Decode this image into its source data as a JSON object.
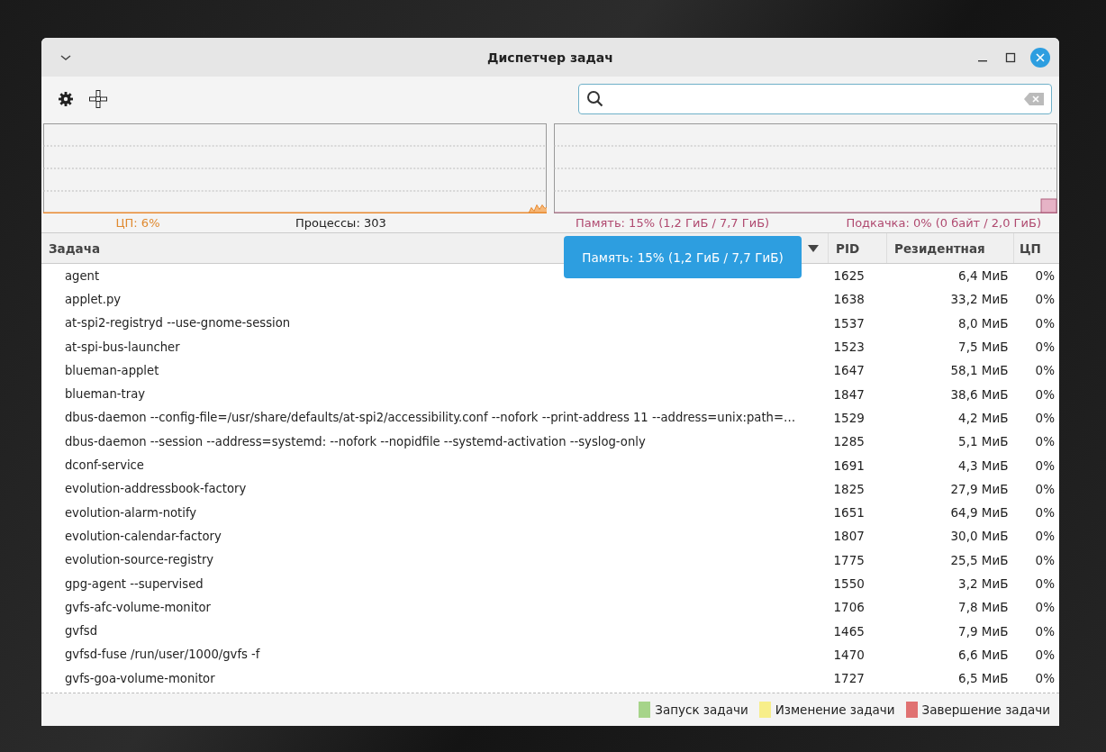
{
  "window": {
    "title": "Диспетчер задач"
  },
  "stats": {
    "cpu": "ЦП: 6%",
    "processes": "Процессы: 303",
    "memory": "Память: 15% (1,2 ГиБ / 7,7 ГиБ)",
    "swap": "Подкачка: 0% (0 байт / 2,0 ГиБ)"
  },
  "tooltip": {
    "text": "Память: 15% (1,2 ГиБ / 7,7 ГиБ)"
  },
  "table": {
    "columns": [
      {
        "label": "Задача",
        "sorted": true
      },
      {
        "label": "PID",
        "sorted": false
      },
      {
        "label": "Резидентная",
        "sorted": false
      },
      {
        "label": "ЦП",
        "sorted": false
      }
    ],
    "rows": [
      [
        "agent",
        "1625",
        "6,4 МиБ",
        "0%"
      ],
      [
        "applet.py",
        "1638",
        "33,2 МиБ",
        "0%"
      ],
      [
        "at-spi2-registryd --use-gnome-session",
        "1537",
        "8,0 МиБ",
        "0%"
      ],
      [
        "at-spi-bus-launcher",
        "1523",
        "7,5 МиБ",
        "0%"
      ],
      [
        "blueman-applet",
        "1647",
        "58,1 МиБ",
        "0%"
      ],
      [
        "blueman-tray",
        "1847",
        "38,6 МиБ",
        "0%"
      ],
      [
        "dbus-daemon --config-file=/usr/share/defaults/at-spi2/accessibility.conf --nofork --print-address 11 --address=unix:path=…",
        "1529",
        "4,2 МиБ",
        "0%"
      ],
      [
        "dbus-daemon --session --address=systemd: --nofork --nopidfile --systemd-activation --syslog-only",
        "1285",
        "5,1 МиБ",
        "0%"
      ],
      [
        "dconf-service",
        "1691",
        "4,3 МиБ",
        "0%"
      ],
      [
        "evolution-addressbook-factory",
        "1825",
        "27,9 МиБ",
        "0%"
      ],
      [
        "evolution-alarm-notify",
        "1651",
        "64,9 МиБ",
        "0%"
      ],
      [
        "evolution-calendar-factory",
        "1807",
        "30,0 МиБ",
        "0%"
      ],
      [
        "evolution-source-registry",
        "1775",
        "25,5 МиБ",
        "0%"
      ],
      [
        "gpg-agent --supervised",
        "1550",
        "3,2 МиБ",
        "0%"
      ],
      [
        "gvfs-afc-volume-monitor",
        "1706",
        "7,8 МиБ",
        "0%"
      ],
      [
        "gvfsd",
        "1465",
        "7,9 МиБ",
        "0%"
      ],
      [
        "gvfsd-fuse /run/user/1000/gvfs -f",
        "1470",
        "6,6 МиБ",
        "0%"
      ],
      [
        "gvfs-goa-volume-monitor",
        "1727",
        "6,5 МиБ",
        "0%"
      ]
    ]
  },
  "legend": [
    {
      "label": "Запуск задачи",
      "color": "#a6d48a"
    },
    {
      "label": "Изменение задачи",
      "color": "#f7ee8a"
    },
    {
      "label": "Завершение задачи",
      "color": "#e07272"
    }
  ]
}
